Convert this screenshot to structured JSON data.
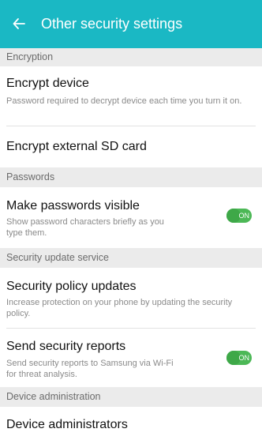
{
  "header": {
    "title": "Other security settings",
    "back_icon": "arrow-left-icon"
  },
  "colors": {
    "accent": "#1ab8c4",
    "toggle_on": "#4cb856",
    "section_bg": "#ebebeb"
  },
  "sections": {
    "encryption": "Encryption",
    "passwords": "Passwords",
    "security_update": "Security update service",
    "device_admin": "Device administration"
  },
  "items": {
    "encrypt_device": {
      "title": "Encrypt device",
      "subtitle": "Password required to decrypt device each time you turn it on."
    },
    "encrypt_sd": {
      "title": "Encrypt external SD card"
    },
    "make_passwords_visible": {
      "title": "Make passwords visible",
      "subtitle": "Show password characters briefly as you type them.",
      "toggle_label": "ON"
    },
    "security_policy_updates": {
      "title": "Security policy updates",
      "subtitle": "Increase protection on your phone by updating the security policy."
    },
    "send_security_reports": {
      "title": "Send security reports",
      "subtitle": "Send security reports to Samsung via Wi-Fi for threat analysis.",
      "toggle_label": "ON"
    },
    "device_administrators": {
      "title": "Device administrators"
    }
  }
}
